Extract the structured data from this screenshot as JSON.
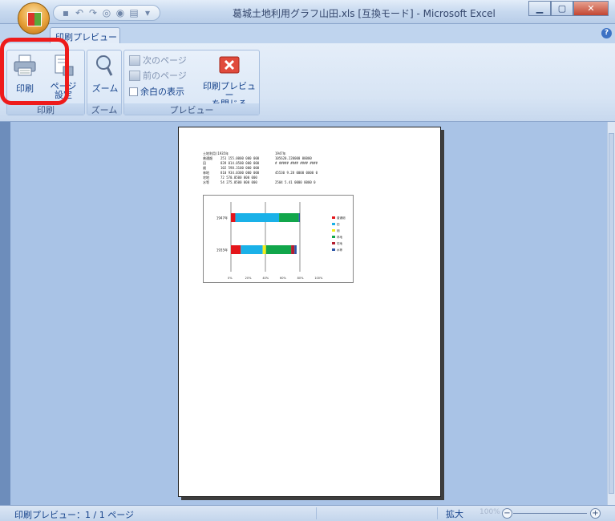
{
  "window": {
    "title": "葛城土地利用グラフ山田.xls  [互換モード] - Microsoft Excel",
    "minimize": "▁",
    "maximize": "▢",
    "close": "✕"
  },
  "ribbon": {
    "active_tab": "印刷プレビュー",
    "help": "?",
    "groups": {
      "print": {
        "label": "印刷",
        "print_button": "印刷",
        "page_setup_line1": "ページ",
        "page_setup_line2": "設定"
      },
      "zoom": {
        "label": "ズーム",
        "zoom_button": "ズーム"
      },
      "preview": {
        "label": "プレビュー",
        "next_page": "次のページ",
        "prev_page": "前のページ",
        "show_margins": "余白の表示",
        "close_line1": "印刷プレビュー",
        "close_line2": "を閉じる"
      }
    }
  },
  "page_sheet": {
    "header_left": "土地利用(1935年",
    "header_right": "1947年",
    "rows": [
      {
        "label": "普通畑",
        "v1": "251 155.0000 000 000",
        "v2": "105620.220000 00000"
      },
      {
        "label": "田",
        "v1": "839 014.0500 000 000",
        "v2": "# ##### #### #### ####"
      },
      {
        "label": "畑",
        "v1": "102 598.3100 000 000",
        "v2": ""
      },
      {
        "label": "林地",
        "v1": "810 934.0300 000 000",
        "v2": "45530 9.28 0000 0000 0"
      },
      {
        "label": "宅地",
        "v1": "72 570.0500 000 000",
        "v2": ""
      },
      {
        "label": "水等",
        "v1": "54 275.0500 000 000",
        "v2": "2504 5.41 0000 0000 0"
      }
    ]
  },
  "chart_data": {
    "type": "bar",
    "orientation": "horizontal",
    "stacked": true,
    "categories": [
      "1947年",
      "1935年"
    ],
    "series": [
      {
        "name": "普通畑",
        "color": "#e4161b",
        "values": [
          4,
          9
        ]
      },
      {
        "name": "田",
        "color": "#1ab1e8",
        "values": [
          40,
          20
        ]
      },
      {
        "name": "畑",
        "color": "#f3ec1a",
        "values": [
          0,
          3
        ]
      },
      {
        "name": "林地",
        "color": "#11a64b",
        "values": [
          18,
          23
        ]
      },
      {
        "name": "宅地",
        "color": "#b31e2f",
        "values": [
          0,
          3
        ]
      },
      {
        "name": "水等",
        "color": "#2c55a6",
        "values": [
          1,
          2
        ]
      }
    ],
    "xlim": [
      0,
      63
    ],
    "xticks": [
      "0%",
      "20%",
      "40%",
      "60%",
      "80%",
      "100%"
    ],
    "legend": "right"
  },
  "status": {
    "text": "印刷プレビュー：1 / 1 ページ",
    "zoom_label": "拡大",
    "zoom_pct": "100%",
    "minus": "−",
    "plus": "+"
  }
}
